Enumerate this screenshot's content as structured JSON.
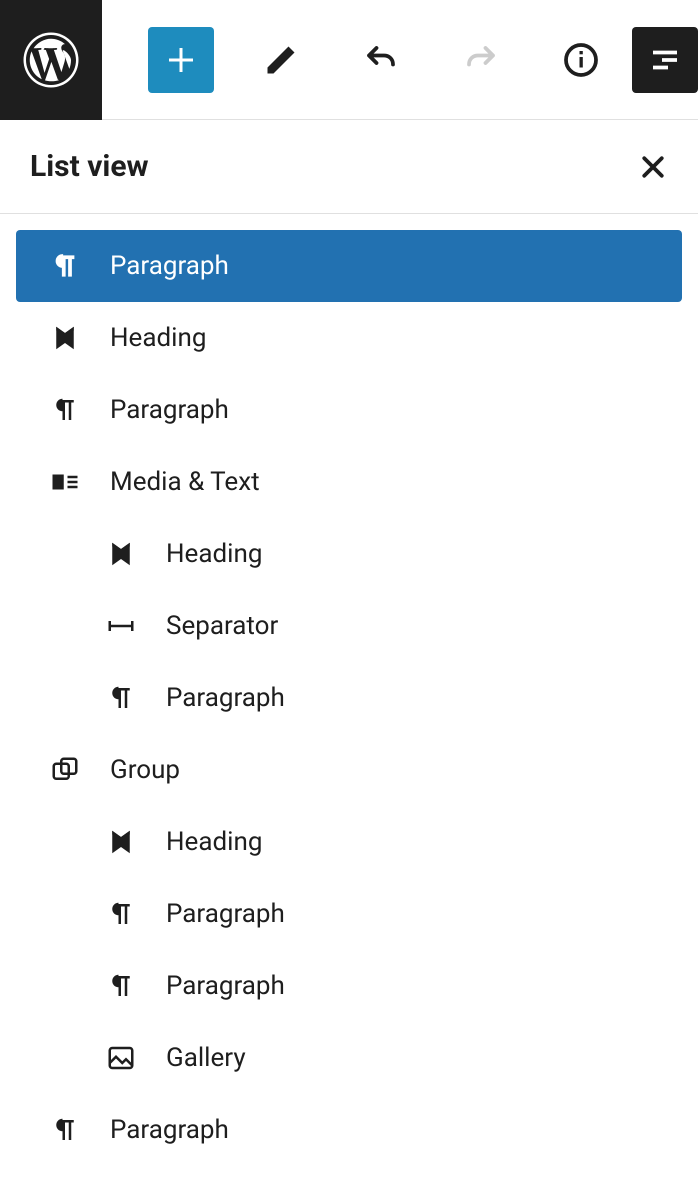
{
  "panel": {
    "title": "List view"
  },
  "items": [
    {
      "icon": "paragraph",
      "label": "Paragraph",
      "selected": true,
      "indent": false
    },
    {
      "icon": "heading",
      "label": "Heading",
      "selected": false,
      "indent": false
    },
    {
      "icon": "paragraph",
      "label": "Paragraph",
      "selected": false,
      "indent": false
    },
    {
      "icon": "media-text",
      "label": "Media & Text",
      "selected": false,
      "indent": false
    },
    {
      "icon": "heading",
      "label": "Heading",
      "selected": false,
      "indent": true
    },
    {
      "icon": "separator",
      "label": "Separator",
      "selected": false,
      "indent": true
    },
    {
      "icon": "paragraph",
      "label": "Paragraph",
      "selected": false,
      "indent": true
    },
    {
      "icon": "group",
      "label": "Group",
      "selected": false,
      "indent": false
    },
    {
      "icon": "heading",
      "label": "Heading",
      "selected": false,
      "indent": true
    },
    {
      "icon": "paragraph",
      "label": "Paragraph",
      "selected": false,
      "indent": true
    },
    {
      "icon": "paragraph",
      "label": "Paragraph",
      "selected": false,
      "indent": true
    },
    {
      "icon": "gallery",
      "label": "Gallery",
      "selected": false,
      "indent": true
    },
    {
      "icon": "paragraph",
      "label": "Paragraph",
      "selected": false,
      "indent": false
    }
  ]
}
